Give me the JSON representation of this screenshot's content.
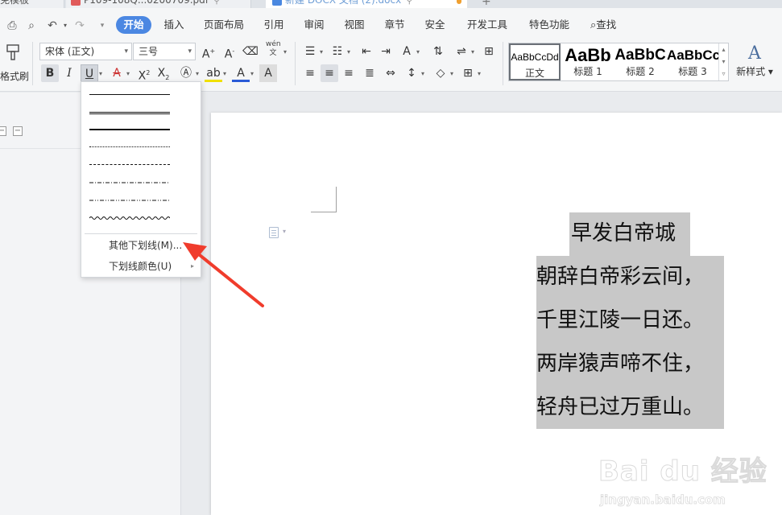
{
  "tabs": [
    {
      "label": "免模板"
    },
    {
      "label": "P109-108Q...0200709.pdf"
    },
    {
      "label": "新建 DOCX 文档 (2).docx"
    }
  ],
  "menu": {
    "items": [
      "开始",
      "插入",
      "页面布局",
      "引用",
      "审阅",
      "视图",
      "章节",
      "安全",
      "开发工具",
      "特色功能"
    ],
    "search": "查找"
  },
  "ribbon": {
    "format_painter": "格式刷",
    "font_name": "宋体 (正文)",
    "font_size": "三号",
    "styles": [
      {
        "preview": "AaBbCcDd",
        "name": "正文"
      },
      {
        "preview": "AaBb",
        "name": "标题 1"
      },
      {
        "preview": "AaBbC",
        "name": "标题 2"
      },
      {
        "preview": "AaBbCc",
        "name": "标题 3"
      }
    ],
    "new_style": "新样式",
    "pinyin_glyph": "wén\n文"
  },
  "underline_menu": {
    "more_underlines": "其他下划线(M)...",
    "underline_color": "下划线颜色(U)"
  },
  "document": {
    "poem_title": "早发白帝城",
    "poem_lines": [
      "朝辞白帝彩云间，",
      "千里江陵一日还。",
      "两岸猿声啼不住，",
      "轻舟已过万重山。"
    ]
  },
  "colors": {
    "accent": "#4b87e2",
    "selection_highlight": "#c8c8c8",
    "annotation_arrow": "#f03c2c"
  },
  "watermark": {
    "brand": "Bai du 经验",
    "url": "jingyan.baidu.com"
  }
}
